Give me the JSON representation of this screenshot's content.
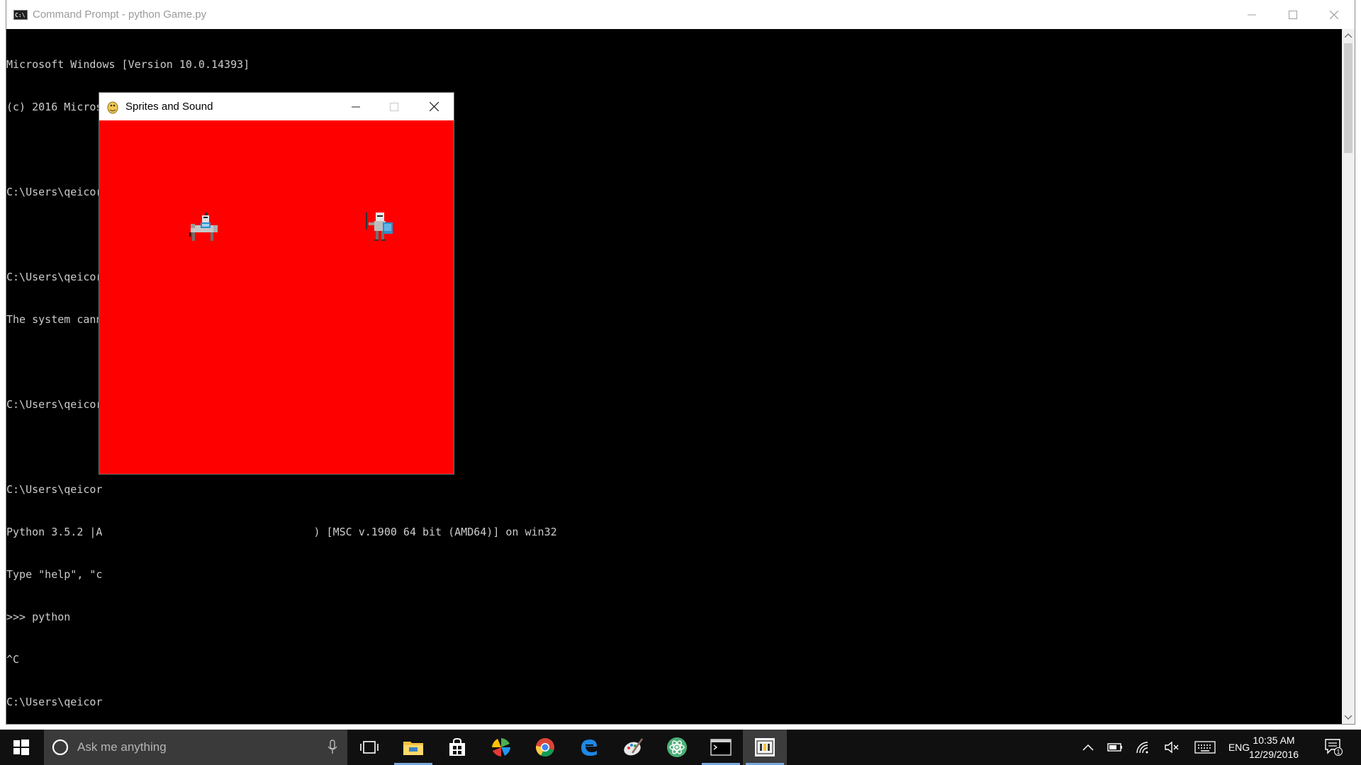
{
  "cmd": {
    "title": "Command Prompt - python  Game.py",
    "icon": "cmd-icon",
    "lines": [
      "Microsoft Windows [Version 10.0.14393]",
      "(c) 2016 Microsoft Corporation. All rights reserved.",
      "",
      "C:\\Users\\qeicorp02>cd Desktop",
      "",
      "C:\\Users\\qeicor",
      "The system cann",
      "",
      "C:\\Users\\qeicor",
      "",
      "C:\\Users\\qeicor",
      "Python 3.5.2 |A                                 ) [MSC v.1900 64 bit (AMD64)] on win32",
      "Type \"help\", \"c",
      ">>> python",
      "^C",
      "C:\\Users\\qeicor"
    ]
  },
  "game": {
    "title": "Sprites and Sound",
    "icon": "pygame-snake-icon",
    "background_color": "#ff0000",
    "sprites": [
      "knight-on-horse-sprite",
      "knight-with-shield-sprite"
    ]
  },
  "taskbar": {
    "search_placeholder": "Ask me anything",
    "tray": {
      "language": "ENG",
      "time": "10:35 AM",
      "date": "12/29/2016",
      "notifications_count": "1"
    }
  }
}
